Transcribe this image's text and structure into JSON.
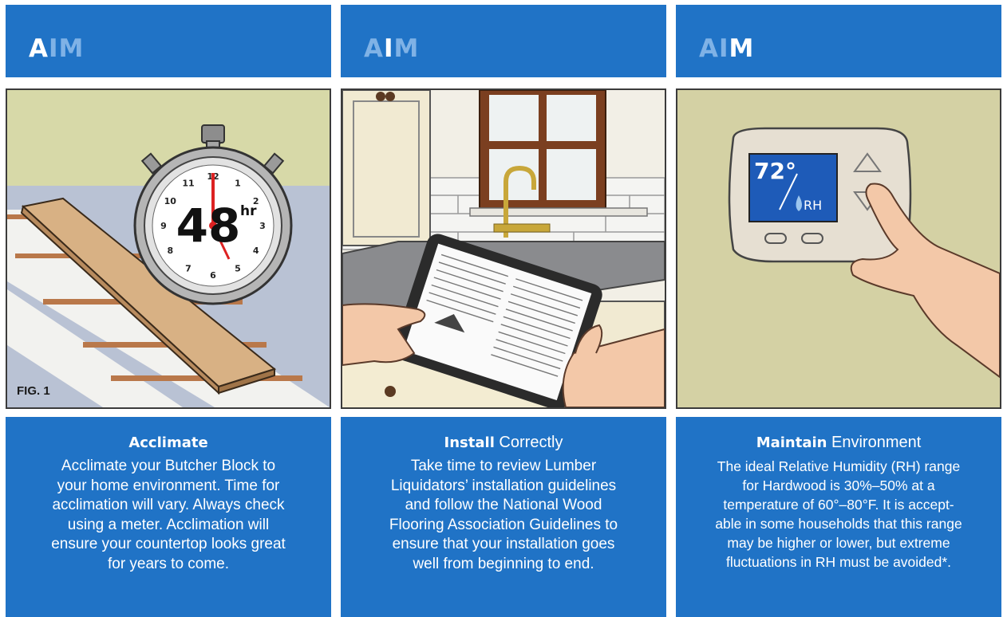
{
  "panels": [
    {
      "aim": [
        "A",
        "I",
        "M"
      ],
      "active": 0,
      "fig_label": "FIG. 1",
      "timer": {
        "digits": "48",
        "unit": "hr",
        "dial": [
          "12",
          "1",
          "2",
          "3",
          "4",
          "5",
          "6",
          "7",
          "8",
          "9",
          "10",
          "11"
        ]
      },
      "title_bold": "Acclimate",
      "title_rest": "",
      "body": "Acclimate your Butcher Block to\nyour home environment. Time for\nacclimation will vary. Always check\nusing a meter. Acclimation will\nensure your countertop looks great\nfor years to come."
    },
    {
      "aim": [
        "A",
        "I",
        "M"
      ],
      "active": 1,
      "title_bold": "Install",
      "title_rest": " Correctly",
      "body": "Take time to review Lumber\nLiquidators’ installation guidelines\nand follow the National Wood\nFlooring Association Guidelines to\nensure that your installation goes\nwell from beginning to end."
    },
    {
      "aim": [
        "A",
        "I",
        "M"
      ],
      "active": 2,
      "thermostat": {
        "temp": "72°",
        "rh": "RH"
      },
      "title_bold": "Maintain",
      "title_rest": " Environment",
      "body": "The ideal Relative Humidity (RH) range\nfor Hardwood is 30%–50% at a\ntemperature of 60°–80°F. It is accept-\nable in some households that this range\nmay be higher or lower, but extreme\nfluctuations in RH must be avoided*."
    }
  ],
  "colors": {
    "header": "#2073c6",
    "aim_inactive": "#7fb2e6",
    "text": "#ffffff"
  }
}
